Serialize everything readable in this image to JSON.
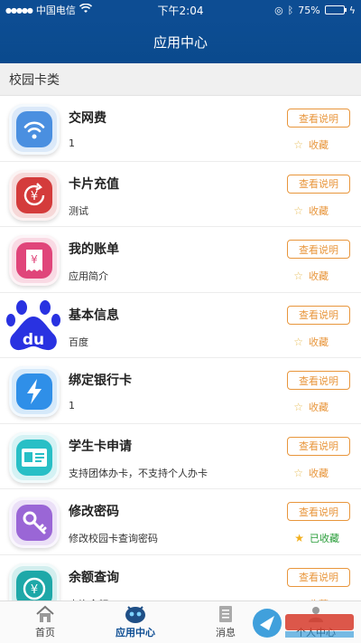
{
  "status_bar": {
    "carrier": "中国电信",
    "time": "下午2:04",
    "battery": "75%",
    "battery_level": 0.75
  },
  "header": {
    "title": "应用中心"
  },
  "section": {
    "title": "校园卡类"
  },
  "items": [
    {
      "icon": "wifi-icon",
      "title": "交网费",
      "desc": "1",
      "button": "查看说明",
      "fav": "收藏",
      "favorited": false,
      "color": "#4a8fe0"
    },
    {
      "icon": "yuan-refresh-icon",
      "title": "卡片充值",
      "desc": "测试",
      "button": "查看说明",
      "fav": "收藏",
      "favorited": false,
      "color": "#d43b3b"
    },
    {
      "icon": "receipt-icon",
      "title": "我的账单",
      "desc": "应用简介",
      "button": "查看说明",
      "fav": "收藏",
      "favorited": false,
      "color": "#e0457a"
    },
    {
      "icon": "baidu-logo-icon",
      "title": "基本信息",
      "desc": "百度",
      "button": "查看说明",
      "fav": "收藏",
      "favorited": false,
      "color": "#2932e1"
    },
    {
      "icon": "lightning-icon",
      "title": "绑定银行卡",
      "desc": "1",
      "button": "查看说明",
      "fav": "收藏",
      "favorited": false,
      "color": "#2f8fe8"
    },
    {
      "icon": "id-card-icon",
      "title": "学生卡申请",
      "desc": "支持团体办卡，不支持个人办卡",
      "button": "查看说明",
      "fav": "收藏",
      "favorited": false,
      "color": "#28bfc6"
    },
    {
      "icon": "key-icon",
      "title": "修改密码",
      "desc": "修改校园卡查询密码",
      "button": "查看说明",
      "fav": "已收藏",
      "favorited": true,
      "color": "#9a66d6"
    },
    {
      "icon": "yuan-coin-icon",
      "title": "余额查询",
      "desc": "查询余额",
      "button": "查看说明",
      "fav": "收藏",
      "favorited": false,
      "color": "#1ea8a8"
    }
  ],
  "tabbar": [
    {
      "label": "首页",
      "icon": "home-icon"
    },
    {
      "label": "应用中心",
      "icon": "robot-icon",
      "active": true
    },
    {
      "label": "消息",
      "icon": "message-icon"
    },
    {
      "label": "个人中心",
      "icon": "person-icon"
    }
  ],
  "colors": {
    "primary": "#0d4d93",
    "accent": "#e8963c",
    "favorited": "#2a9d3a"
  }
}
